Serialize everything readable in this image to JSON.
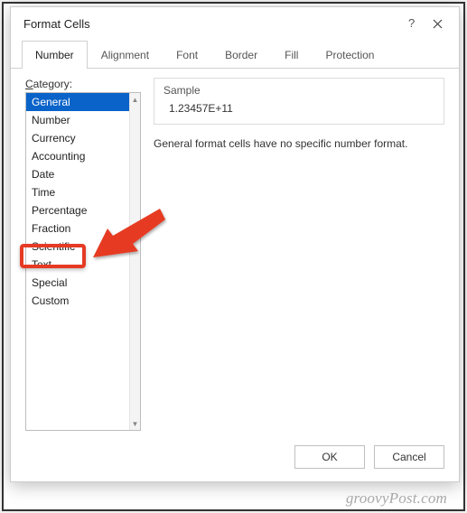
{
  "dialog": {
    "title": "Format Cells"
  },
  "tabs": {
    "items": [
      {
        "label": "Number",
        "active": true
      },
      {
        "label": "Alignment"
      },
      {
        "label": "Font"
      },
      {
        "label": "Border"
      },
      {
        "label": "Fill"
      },
      {
        "label": "Protection"
      }
    ]
  },
  "category": {
    "label_prefix": "C",
    "label_rest": "ategory:",
    "items": [
      "General",
      "Number",
      "Currency",
      "Accounting",
      "Date",
      "Time",
      "Percentage",
      "Fraction",
      "Scientific",
      "Text",
      "Special",
      "Custom"
    ],
    "selected_index": 0
  },
  "sample": {
    "label": "Sample",
    "value": "1.23457E+11"
  },
  "description": "General format cells have no specific number format.",
  "buttons": {
    "ok": "OK",
    "cancel": "Cancel"
  },
  "watermark": "groovyPost.com",
  "annotation": {
    "highlight_item": "Custom"
  },
  "colors": {
    "selection": "#0a63c9",
    "annotation": "#e63a24"
  }
}
